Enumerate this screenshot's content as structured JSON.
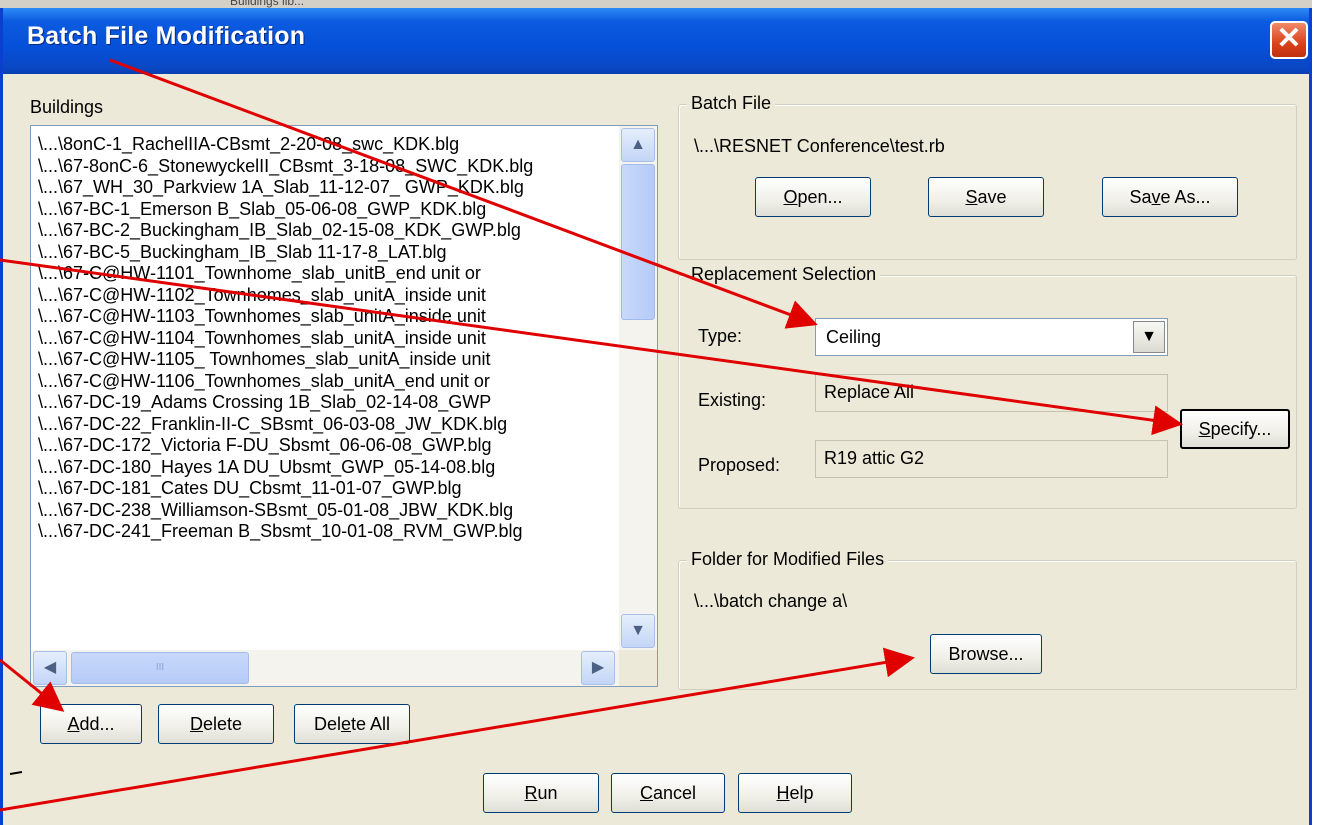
{
  "window": {
    "title": "Batch File Modification",
    "close_glyph": "✕",
    "background_text": "Buildings lib..."
  },
  "buildings": {
    "label": "Buildings",
    "items": [
      "\\...\\8onC-1_RachelIIA-CBsmt_2-20-08_swc_KDK.blg",
      "\\...\\67-8onC-6_StonewyckelII_CBsmt_3-18-08_SWC_KDK.blg",
      "\\...\\67_WH_30_Parkview 1A_Slab_11-12-07_ GWP_KDK.blg",
      "\\...\\67-BC-1_Emerson B_Slab_05-06-08_GWP_KDK.blg",
      "\\...\\67-BC-2_Buckingham_IB_Slab_02-15-08_KDK_GWP.blg",
      "\\...\\67-BC-5_Buckingham_IB_Slab 11-17-8_LAT.blg",
      "\\...\\67-C@HW-1101_Townhome_slab_unitB_end unit or",
      "\\...\\67-C@HW-1102_Townhomes_slab_unitA_inside unit",
      "\\...\\67-C@HW-1103_Townhomes_slab_unitA_inside unit",
      "\\...\\67-C@HW-1104_Townhomes_slab_unitA_inside unit",
      "\\...\\67-C@HW-1105_ Townhomes_slab_unitA_inside unit",
      "\\...\\67-C@HW-1106_Townhomes_slab_unitA_end unit or",
      "\\...\\67-DC-19_Adams Crossing 1B_Slab_02-14-08_GWP",
      "\\...\\67-DC-22_Franklin-II-C_SBsmt_06-03-08_JW_KDK.blg",
      "\\...\\67-DC-172_Victoria F-DU_Sbsmt_06-06-08_GWP.blg",
      "\\...\\67-DC-180_Hayes 1A DU_Ubsmt_GWP_05-14-08.blg",
      "\\...\\67-DC-181_Cates DU_Cbsmt_11-01-07_GWP.blg",
      "\\...\\67-DC-238_Williamson-SBsmt_05-01-08_JBW_KDK.blg",
      "\\...\\67-DC-241_Freeman B_Sbsmt_10-01-08_RVM_GWP.blg"
    ],
    "scroll_up": "▲",
    "scroll_down": "▼",
    "scroll_left": "◀",
    "scroll_right": "▶",
    "thumb_grip": "III",
    "buttons": {
      "add": {
        "pre": "",
        "u": "A",
        "post": "dd..."
      },
      "delete": {
        "pre": "",
        "u": "D",
        "post": "elete"
      },
      "delete_all": {
        "pre": "Del",
        "u": "e",
        "post": "te All"
      }
    }
  },
  "batch_file": {
    "legend": "Batch File",
    "path": "\\...\\RESNET Conference\\test.rb",
    "open": {
      "pre": "",
      "u": "O",
      "post": "pen..."
    },
    "save": {
      "pre": "",
      "u": "S",
      "post": "ave"
    },
    "save_as": {
      "pre": "Sa",
      "u": "v",
      "post": "e As..."
    }
  },
  "replacement": {
    "legend": "Replacement Selection",
    "type_label": "Type:",
    "type_value": "Ceiling",
    "combo_arrow": "▼",
    "existing_label": "Existing:",
    "existing_value": "Replace All",
    "specify": {
      "pre": "",
      "u": "S",
      "post": "pecify..."
    },
    "proposed_label": "Proposed:",
    "proposed_value": "R19 attic G2"
  },
  "folder": {
    "legend": "Folder for Modified Files",
    "path": "\\...\\batch change a\\",
    "browse": "Browse..."
  },
  "footer": {
    "run": {
      "pre": "",
      "u": "R",
      "post": "un"
    },
    "cancel": {
      "pre": "",
      "u": "C",
      "post": "ancel"
    },
    "help": {
      "pre": "",
      "u": "H",
      "post": "elp"
    }
  },
  "colors": {
    "title_bar": "#0a47c4",
    "window_bg": "#ece9d8",
    "annotation_arrow": "#e00000"
  }
}
